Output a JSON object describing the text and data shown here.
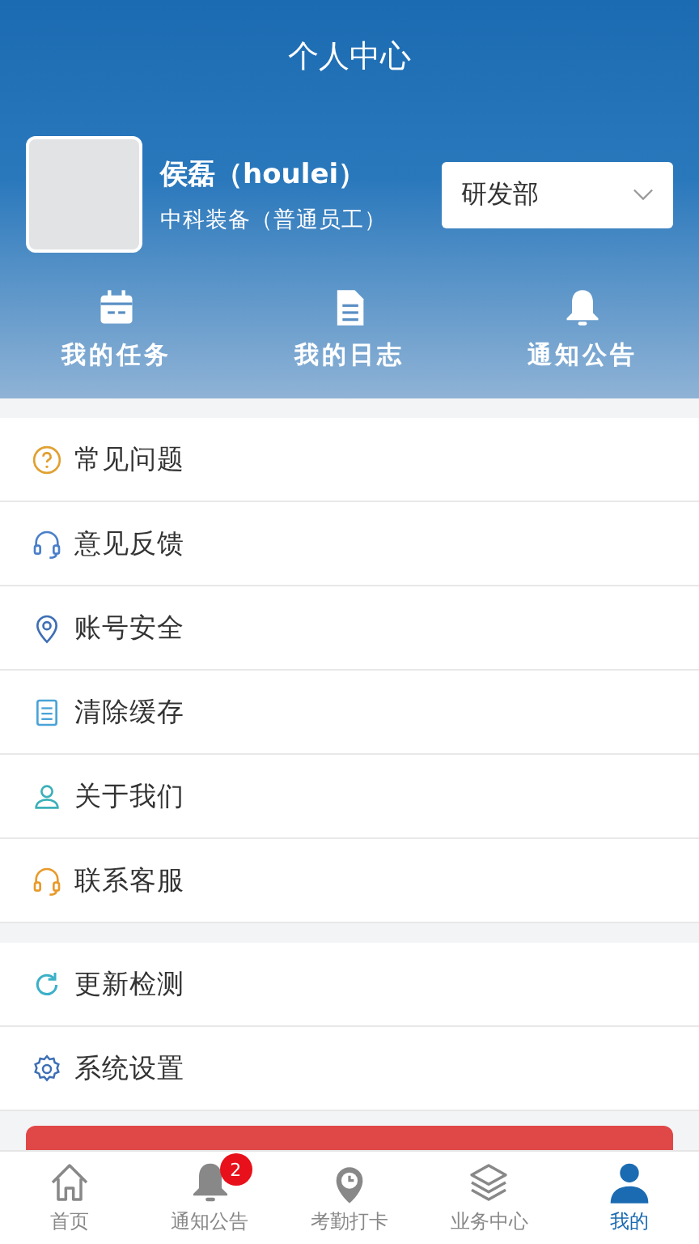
{
  "header": {
    "title": "个人中心"
  },
  "profile": {
    "name": "侯磊（houlei）",
    "company": "中科装备（普通员工）",
    "department": "研发部"
  },
  "shortcuts": [
    {
      "kind": "calendar",
      "label": "我的任务"
    },
    {
      "kind": "document",
      "label": "我的日志"
    },
    {
      "kind": "bell",
      "label": "通知公告"
    }
  ],
  "menu_groups": [
    [
      {
        "kind": "question",
        "color": "#e0a030",
        "label": "常见问题"
      },
      {
        "kind": "headset",
        "color": "#4a7fc9",
        "label": "意见反馈"
      },
      {
        "kind": "location",
        "color": "#3d6fb5",
        "label": "账号安全"
      },
      {
        "kind": "note",
        "color": "#4aa3d8",
        "label": "清除缓存"
      },
      {
        "kind": "user",
        "color": "#3bb0b8",
        "label": "关于我们"
      },
      {
        "kind": "headset",
        "color": "#e89a2a",
        "label": "联系客服"
      }
    ],
    [
      {
        "kind": "refresh",
        "color": "#3bb0c8",
        "label": "更新检测"
      },
      {
        "kind": "gear",
        "color": "#3d6fb5",
        "label": "系统设置"
      }
    ]
  ],
  "tab_bar": [
    {
      "kind": "home",
      "label": "首页",
      "selected": false
    },
    {
      "kind": "bell",
      "label": "通知公告",
      "selected": false,
      "badge": "2"
    },
    {
      "kind": "clock-pin",
      "label": "考勤打卡",
      "selected": false
    },
    {
      "kind": "layers",
      "label": "业务中心",
      "selected": false
    },
    {
      "kind": "person",
      "label": "我的",
      "selected": true
    }
  ]
}
